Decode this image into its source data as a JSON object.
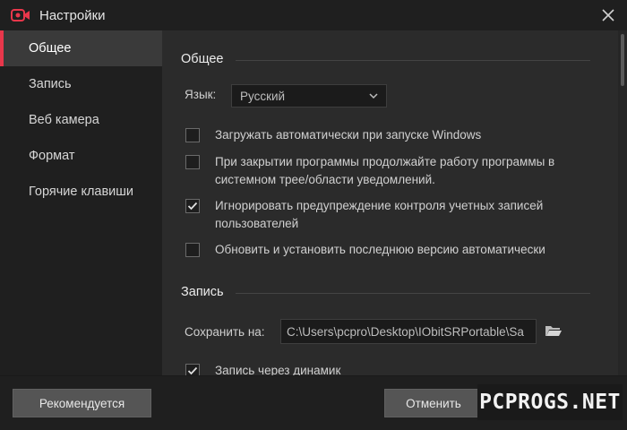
{
  "window": {
    "title": "Настройки",
    "close_icon": "close-icon",
    "app_icon": "camera-record-icon",
    "accent": "#e8374b"
  },
  "sidebar": {
    "items": [
      {
        "label": "Общее",
        "active": true
      },
      {
        "label": "Запись",
        "active": false
      },
      {
        "label": "Веб камера",
        "active": false
      },
      {
        "label": "Формат",
        "active": false
      },
      {
        "label": "Горячие клавиши",
        "active": false
      }
    ]
  },
  "general": {
    "title": "Общее",
    "language_label": "Язык:",
    "language_value": "Русский",
    "options": [
      {
        "label": "Загружать автоматически при запуске Windows",
        "checked": false
      },
      {
        "label": "При закрытии программы продолжайте работу программы в системном трее/области уведомлений.",
        "checked": false
      },
      {
        "label": "Игнорировать предупреждение контроля учетных записей пользователей",
        "checked": true
      },
      {
        "label": "Обновить и установить последнюю версию автоматически",
        "checked": false
      }
    ]
  },
  "recording": {
    "title": "Запись",
    "save_label": "Сохранить на:",
    "save_path": "C:\\Users\\pcpro\\Desktop\\IObitSRPortable\\Sa",
    "speaker_label": "Запись через динамик",
    "speaker_checked": true
  },
  "footer": {
    "recommended_label": "Рекомендуется",
    "cancel_label": "Отменить"
  },
  "watermark": "PCPROGS.NET"
}
